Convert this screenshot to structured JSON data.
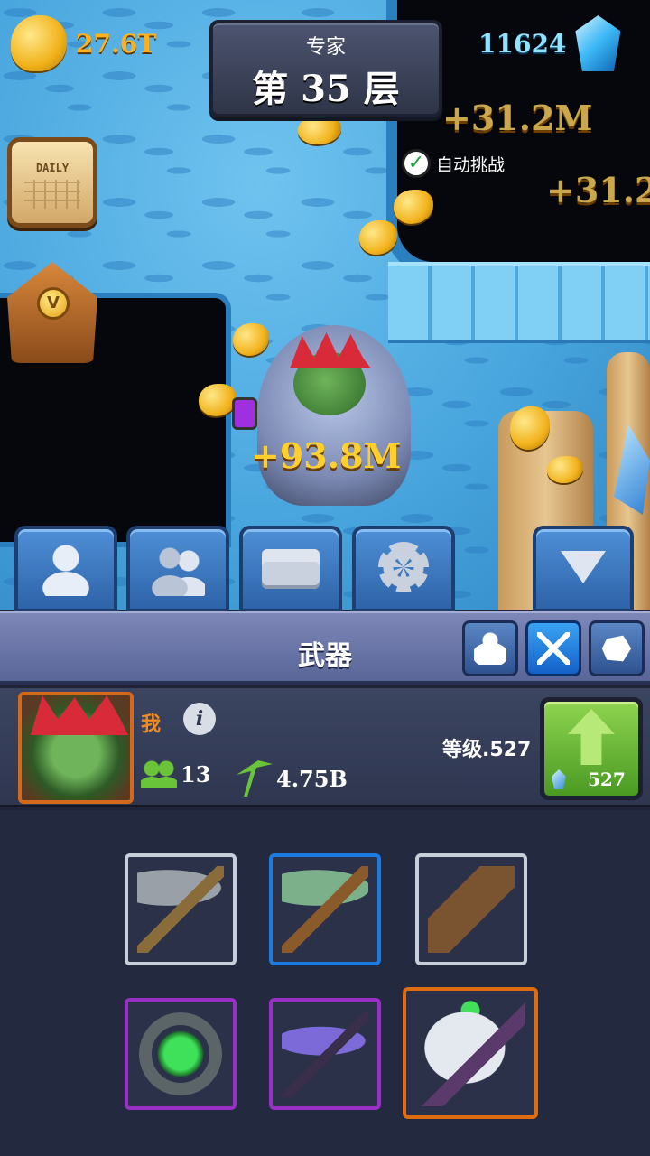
{
  "hud": {
    "gold_amount": "27.6T",
    "gem_amount": "11624",
    "difficulty": "专家",
    "floor_label": "第 35 层",
    "auto_challenge_label": "自动挑战",
    "auto_challenge_checked": true,
    "daily_label": "DAILY",
    "shop_coin_symbol": "V"
  },
  "floating_rewards": [
    "+31.2M",
    "+31.2",
    "+93.8M"
  ],
  "tabs": [
    {
      "name": "hero",
      "icon": "person-icon"
    },
    {
      "name": "team",
      "icon": "people-icon"
    },
    {
      "name": "chest",
      "icon": "chest-icon"
    },
    {
      "name": "settings",
      "icon": "gear-icon"
    },
    {
      "name": "collapse",
      "icon": "triangle-down-icon"
    }
  ],
  "panel": {
    "title": "武器",
    "categories": [
      {
        "icon": "strength-icon",
        "active": false
      },
      {
        "icon": "crossed-weapons-icon",
        "active": true
      },
      {
        "icon": "rock-icon",
        "active": false
      }
    ]
  },
  "player": {
    "name": "我",
    "info_symbol": "i",
    "followers": "13",
    "mining_power": "4.75B",
    "level_text": "等级.527",
    "upgrade_cost": "527"
  },
  "weapons": [
    {
      "name": "iron-pickaxe",
      "rarity": "common"
    },
    {
      "name": "emerald-pickaxe",
      "rarity": "rare"
    },
    {
      "name": "emerald-drill",
      "rarity": "common"
    },
    {
      "name": "emerald-ring",
      "rarity": "epic"
    },
    {
      "name": "void-scythe",
      "rarity": "epic"
    },
    {
      "name": "emerald-battle-axe",
      "rarity": "legendary"
    }
  ],
  "colors": {
    "common": "#c9cfd9",
    "rare": "#1c7be0",
    "epic": "#9a2fc8",
    "legendary": "#de6d12",
    "gold_text": "#ffb21c",
    "gem_text": "#8fe3ff",
    "upgrade_green": "#6ab83a"
  }
}
